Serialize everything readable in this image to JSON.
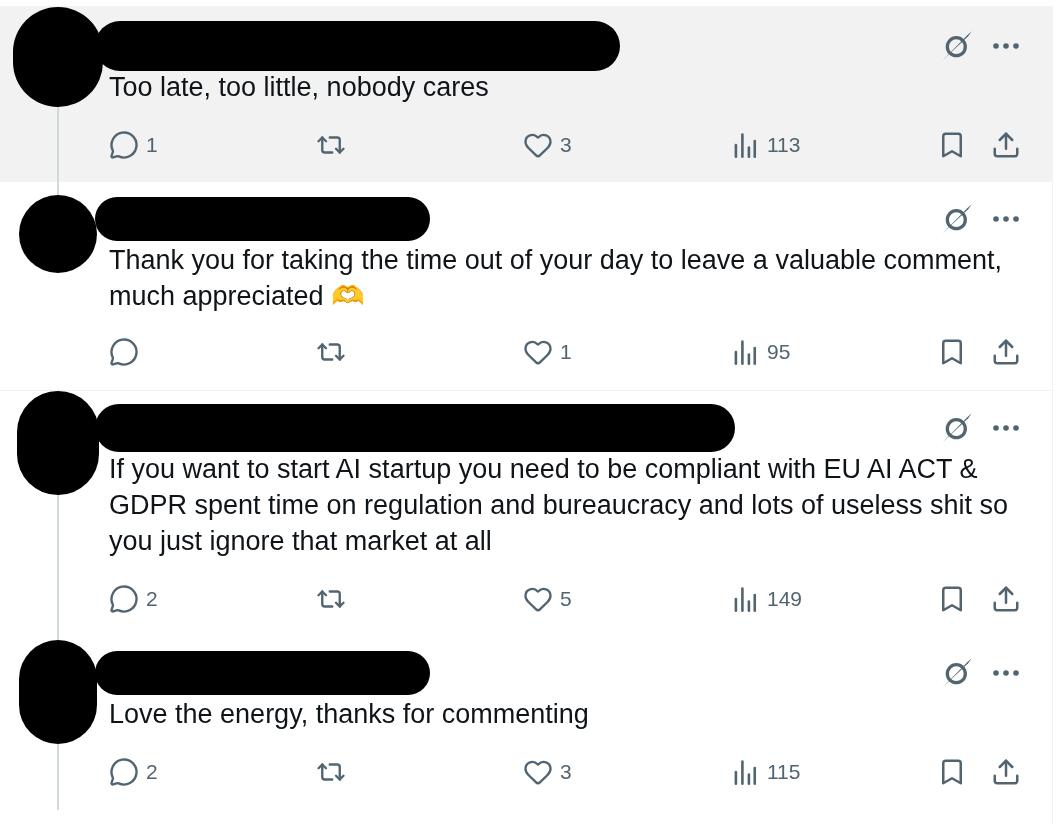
{
  "posts": [
    {
      "author_redacted": true,
      "highlighted": true,
      "thread_continues": true,
      "text": "Too late, too little, nobody cares",
      "actions": {
        "replies": "1",
        "likes": "3",
        "views": "113"
      }
    },
    {
      "author_redacted": true,
      "highlighted": false,
      "thread_continues": false,
      "text": "Thank you for taking the time out of your day to leave a valuable comment, much appreciated 🫶",
      "actions": {
        "likes": "1",
        "views": "95"
      }
    },
    {
      "author_redacted": true,
      "highlighted": false,
      "thread_continues": true,
      "text": "If you want to start AI startup you need to be compliant with EU AI ACT & GDPR spent time on regulation and bureaucracy and lots of useless shit so you just ignore that market at all",
      "actions": {
        "replies": "2",
        "likes": "5",
        "views": "149"
      }
    },
    {
      "author_redacted": true,
      "highlighted": false,
      "thread_continues": true,
      "text": "Love the energy, thanks for commenting",
      "actions": {
        "replies": "2",
        "likes": "3",
        "views": "115"
      }
    }
  ]
}
